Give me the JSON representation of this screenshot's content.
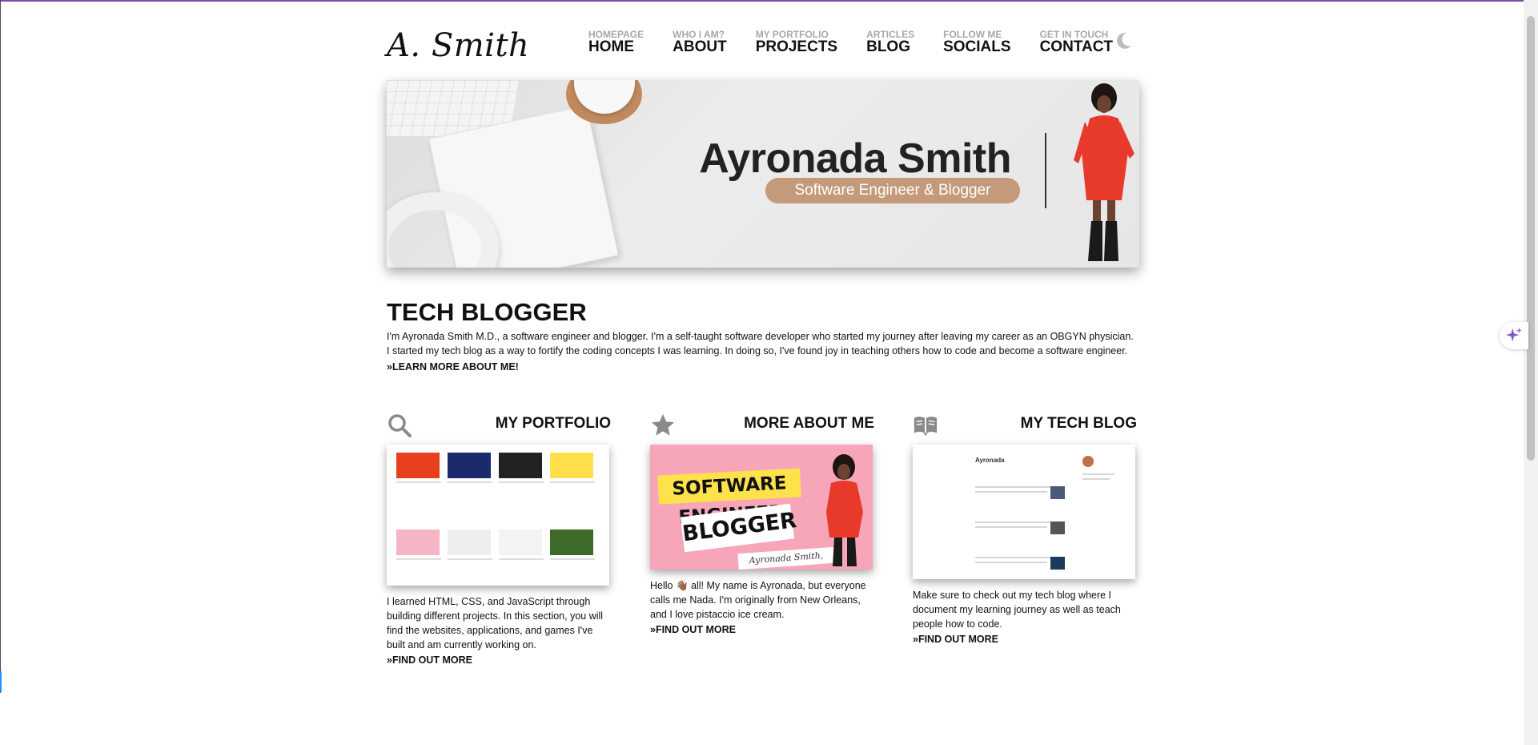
{
  "header": {
    "logo": "A. Smith",
    "nav": [
      {
        "sub": "HOMEPAGE",
        "main": "HOME"
      },
      {
        "sub": "WHO I AM?",
        "main": "ABOUT"
      },
      {
        "sub": "MY PORTFOLIO",
        "main": "PROJECTS"
      },
      {
        "sub": "ARTICLES",
        "main": "BLOG"
      },
      {
        "sub": "FOLLOW ME",
        "main": "SOCIALS"
      },
      {
        "sub": "GET IN TOUCH",
        "main": "CONTACT"
      }
    ],
    "theme_toggle_icon": "moon-icon"
  },
  "hero": {
    "name": "Ayronada Smith",
    "tagline": "Software Engineer & Blogger"
  },
  "intro": {
    "title": "TECH BLOGGER",
    "text": "I'm Ayronada Smith M.D., a software engineer and blogger. I'm a self-taught software developer who started my journey after leaving my career as an OBGYN physician. I started my tech blog as a way to fortify the coding concepts I was learning. In doing so, I've found joy in teaching others how to code and become a software engineer.",
    "link": "»LEARN MORE ABOUT ME!"
  },
  "cards": {
    "portfolio": {
      "title": "MY PORTFOLIO",
      "icon": "search-icon",
      "text": "I learned HTML, CSS, and JavaScript through building different projects. In this section, you will find the websites, applications, and games I've built and am currently working on.",
      "link": "»FIND OUT MORE"
    },
    "about": {
      "title": "MORE ABOUT ME",
      "icon": "star-icon",
      "text": "Hello 👋🏾 all! My name is Ayronada, but everyone calls me Nada. I'm originally from New Orleans, and I love pistaccio ice cream.",
      "link": "»FIND OUT MORE",
      "image": {
        "line1": "SOFTWARE ENGINEER",
        "line2": "BLOGGER",
        "signature": "Ayronada Smith, M.D."
      }
    },
    "blog": {
      "title": "MY TECH BLOG",
      "icon": "book-open-icon",
      "text": "Make sure to check out my tech blog where I document my learning journey as well as teach people how to code.",
      "link": "»FIND OUT MORE",
      "image": {
        "heading": "Ayronada"
      }
    }
  },
  "colors": {
    "accent_top": "#7b4fa8",
    "tag_bg": "#c49a7a",
    "hero_dress": "#e83a2a",
    "about_pink": "#f7a6b9",
    "about_yellow": "#ffe14b"
  }
}
